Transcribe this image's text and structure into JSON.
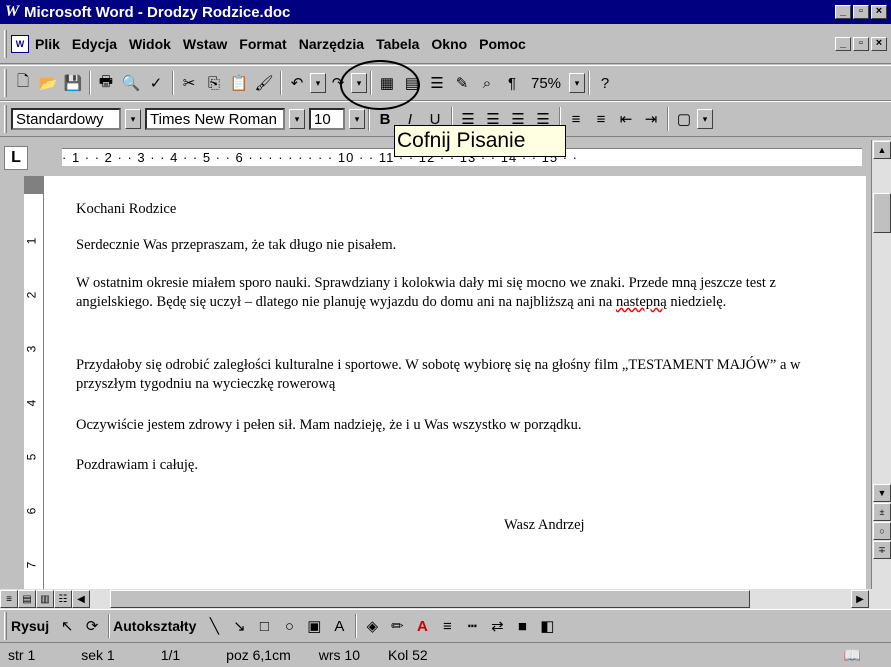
{
  "window": {
    "title": "Microsoft Word - Drodzy Rodzice.doc",
    "icon": "word-icon"
  },
  "menu": {
    "items": [
      "Plik",
      "Edycja",
      "Widok",
      "Wstaw",
      "Format",
      "Narzędzia",
      "Tabela",
      "Okno",
      "Pomoc"
    ]
  },
  "formatting": {
    "style": "Standardowy",
    "font": "Times New Roman",
    "size": "10"
  },
  "toolbar": {
    "zoom": "75%"
  },
  "tooltip": {
    "text": "Cofnij Pisanie"
  },
  "ruler": {
    "marks": "· 1 · · 2 · · 3 · · 4 · · 5 · · 6 · · · · · · · · · 10 · · 11 · · 12 · · 13 · · 14 · · 15 · ·"
  },
  "vruler": {
    "marks": [
      "1",
      "2",
      "3",
      "4",
      "5",
      "6",
      "7"
    ]
  },
  "document": {
    "p1": "Kochani Rodzice",
    "p2": "Serdecznie Was przepraszam, że tak długo nie pisałem.",
    "p3a": "W ostatnim okresie miałem sporo nauki. Sprawdziany i kolokwia dały mi się mocno we znaki. Przede mną jeszcze test z angielskiego. Będę się uczył – dlatego nie planuję wyjazdu do domu ani na najbliższą ani na ",
    "p3b": "nastepną",
    "p3c": " niedzielę.",
    "p4": "Przydałoby się odrobić zaległości kulturalne i sportowe. W sobotę wybiorę się na głośny film „TESTAMENT MAJÓW” a w przyszłym tygodniu na wycieczkę rowerową",
    "p5": "Oczywiście jestem zdrowy i pełen sił. Mam nadzieję, że i u Was wszystko w porządku.",
    "p6": "Pozdrawiam i całuję.",
    "p7": "Wasz Andrzej"
  },
  "drawing": {
    "draw_label": "Rysuj",
    "shapes_label": "Autokształty"
  },
  "status": {
    "page": "str 1",
    "section": "sek 1",
    "pages": "1/1",
    "position": "poz 6,1cm",
    "line": "wrs 10",
    "column": "Kol 52"
  }
}
